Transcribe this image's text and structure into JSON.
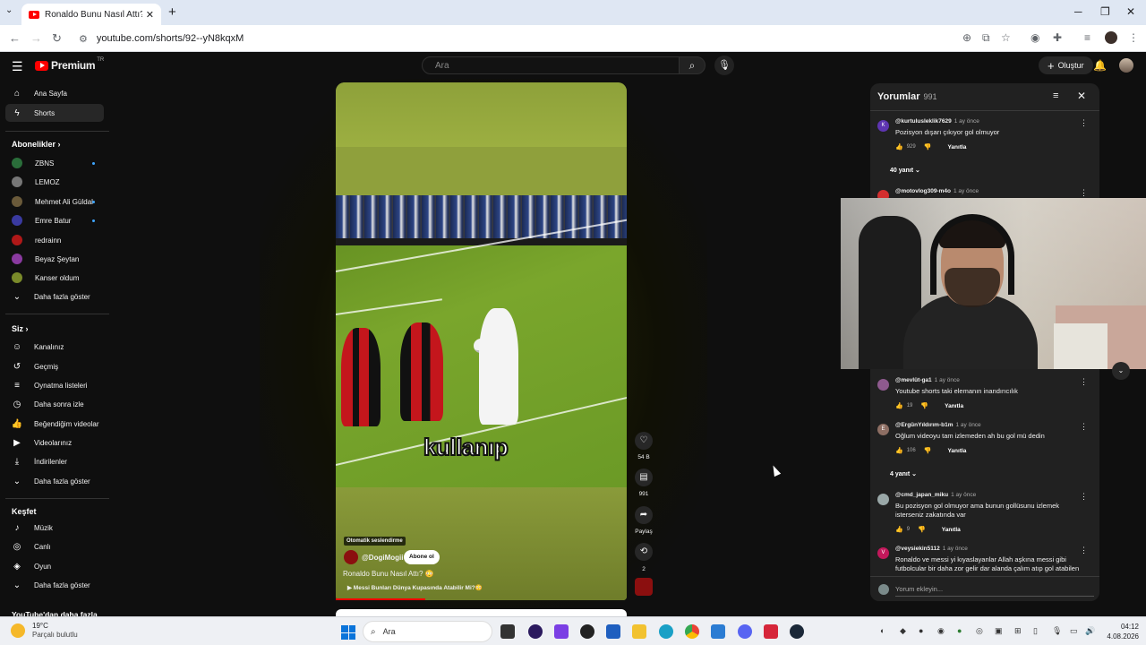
{
  "browser": {
    "tab_title": "Ronaldo Bunu Nasıl Attı? 😳 - Y",
    "url": "youtube.com/shorts/92--yN8kqxM"
  },
  "header": {
    "logo_text": "Premium",
    "logo_region": "TR",
    "search_placeholder": "Ara",
    "create_label": "Oluştur"
  },
  "sidebar": {
    "main": [
      {
        "label": "Ana Sayfa",
        "icon": "home-icon"
      },
      {
        "label": "Shorts",
        "icon": "shorts-icon",
        "active": true
      }
    ],
    "subscriptions_title": "Abonelikler",
    "subscriptions": [
      {
        "label": "ZBNS",
        "color": "#2a6e3a",
        "new": true
      },
      {
        "label": "LEMOZ",
        "color": "#777777",
        "new": false
      },
      {
        "label": "Mehmet Ali Güldal",
        "color": "#6a5a3a",
        "new": true
      },
      {
        "label": "Emre Batur",
        "color": "#3a3aa0",
        "new": true
      },
      {
        "label": "redrainn",
        "color": "#b01818",
        "new": false
      },
      {
        "label": "Beyaz Şeytan",
        "color": "#8a3aa0",
        "new": false
      },
      {
        "label": "Kanser oldum",
        "color": "#7a8a2a",
        "new": false
      }
    ],
    "show_more": "Daha fazla göster",
    "you_title": "Siz",
    "you_items": [
      {
        "label": "Kanalınız",
        "icon": "channel-icon"
      },
      {
        "label": "Geçmiş",
        "icon": "history-icon"
      },
      {
        "label": "Oynatma listeleri",
        "icon": "playlist-icon"
      },
      {
        "label": "Daha sonra izle",
        "icon": "clock-icon"
      },
      {
        "label": "Beğendiğim videolar",
        "icon": "like-icon"
      },
      {
        "label": "Videolarınız",
        "icon": "video-icon"
      },
      {
        "label": "İndirilenler",
        "icon": "download-icon"
      },
      {
        "label": "Daha fazla göster",
        "icon": "chevron-down-icon"
      }
    ],
    "explore_title": "Keşfet",
    "explore_items": [
      {
        "label": "Müzik",
        "icon": "music-icon"
      },
      {
        "label": "Canlı",
        "icon": "live-icon"
      },
      {
        "label": "Oyun",
        "icon": "gaming-icon"
      },
      {
        "label": "Daha fazla göster",
        "icon": "chevron-down-icon"
      }
    ],
    "more_from_youtube": "YouTube'dan daha fazla"
  },
  "short": {
    "caption": "kullanıp",
    "auto_dub": "Otomatik seslendirme",
    "channel": "@DogiMogii",
    "subscribe": "Abone ol",
    "title": "Ronaldo Bunu Nasıl Attı? 😳",
    "link": "▶ Messi Bunları Dünya Kupasında Atabilir Mi?😳",
    "likes": "54 B",
    "comments": "991",
    "share": "Paylaş",
    "remix": "2"
  },
  "comments_panel": {
    "title": "Yorumlar",
    "count": "991",
    "reply_label": "Yanıtla",
    "input_placeholder": "Yorum ekleyin...",
    "items": [
      {
        "user": "@kurtulusleklik7629",
        "time": "1 ay önce",
        "text": "Pozisyon dışarı çıkıyor gol olmuyor",
        "likes": "929",
        "avatar": "K",
        "color": "#5e35b1",
        "replies": "40 yanıt"
      },
      {
        "user": "@motovlog309-m4o",
        "time": "1 ay önce",
        "text": "",
        "likes": "",
        "avatar": "",
        "color": "#d32f2f",
        "replies": ""
      },
      {
        "user": "@mevlüt-ga1",
        "time": "1 ay önce",
        "text": "Youtube shorts taki elemanın inandırıcılık",
        "likes": "19",
        "avatar": "",
        "color": "#8e5a8e",
        "replies": ""
      },
      {
        "user": "@ErgünYıldırım-b1m",
        "time": "1 ay önce",
        "text": "Oğlum videoyu tam izlemeden ah bu gol mü dedin",
        "likes": "106",
        "avatar": "E",
        "color": "#8d6e63",
        "replies": "4 yanıt"
      },
      {
        "user": "@cmd_japan_miku",
        "time": "1 ay önce",
        "text": "Bu  pozisyon gol olmuyor ama bunun gollüsunu izlemek isterseniz zakatında var",
        "likes": "9",
        "avatar": "",
        "color": "#9aa8a8",
        "replies": ""
      },
      {
        "user": "@veysiekin5112",
        "time": "1 ay önce",
        "text": "Ronaldo ve messi yi kıyaslayanlar Allah aşkına messi gibi futbolcular bir daha zor gelir dar alanda çalım atıp gol atabilen",
        "likes": "",
        "avatar": "V",
        "color": "#c2185b",
        "replies": ""
      }
    ]
  },
  "taskbar": {
    "temp": "19°C",
    "weather": "Parçalı bulutlu",
    "search": "Ara",
    "time": "04:12",
    "date": "4.08.2026"
  }
}
